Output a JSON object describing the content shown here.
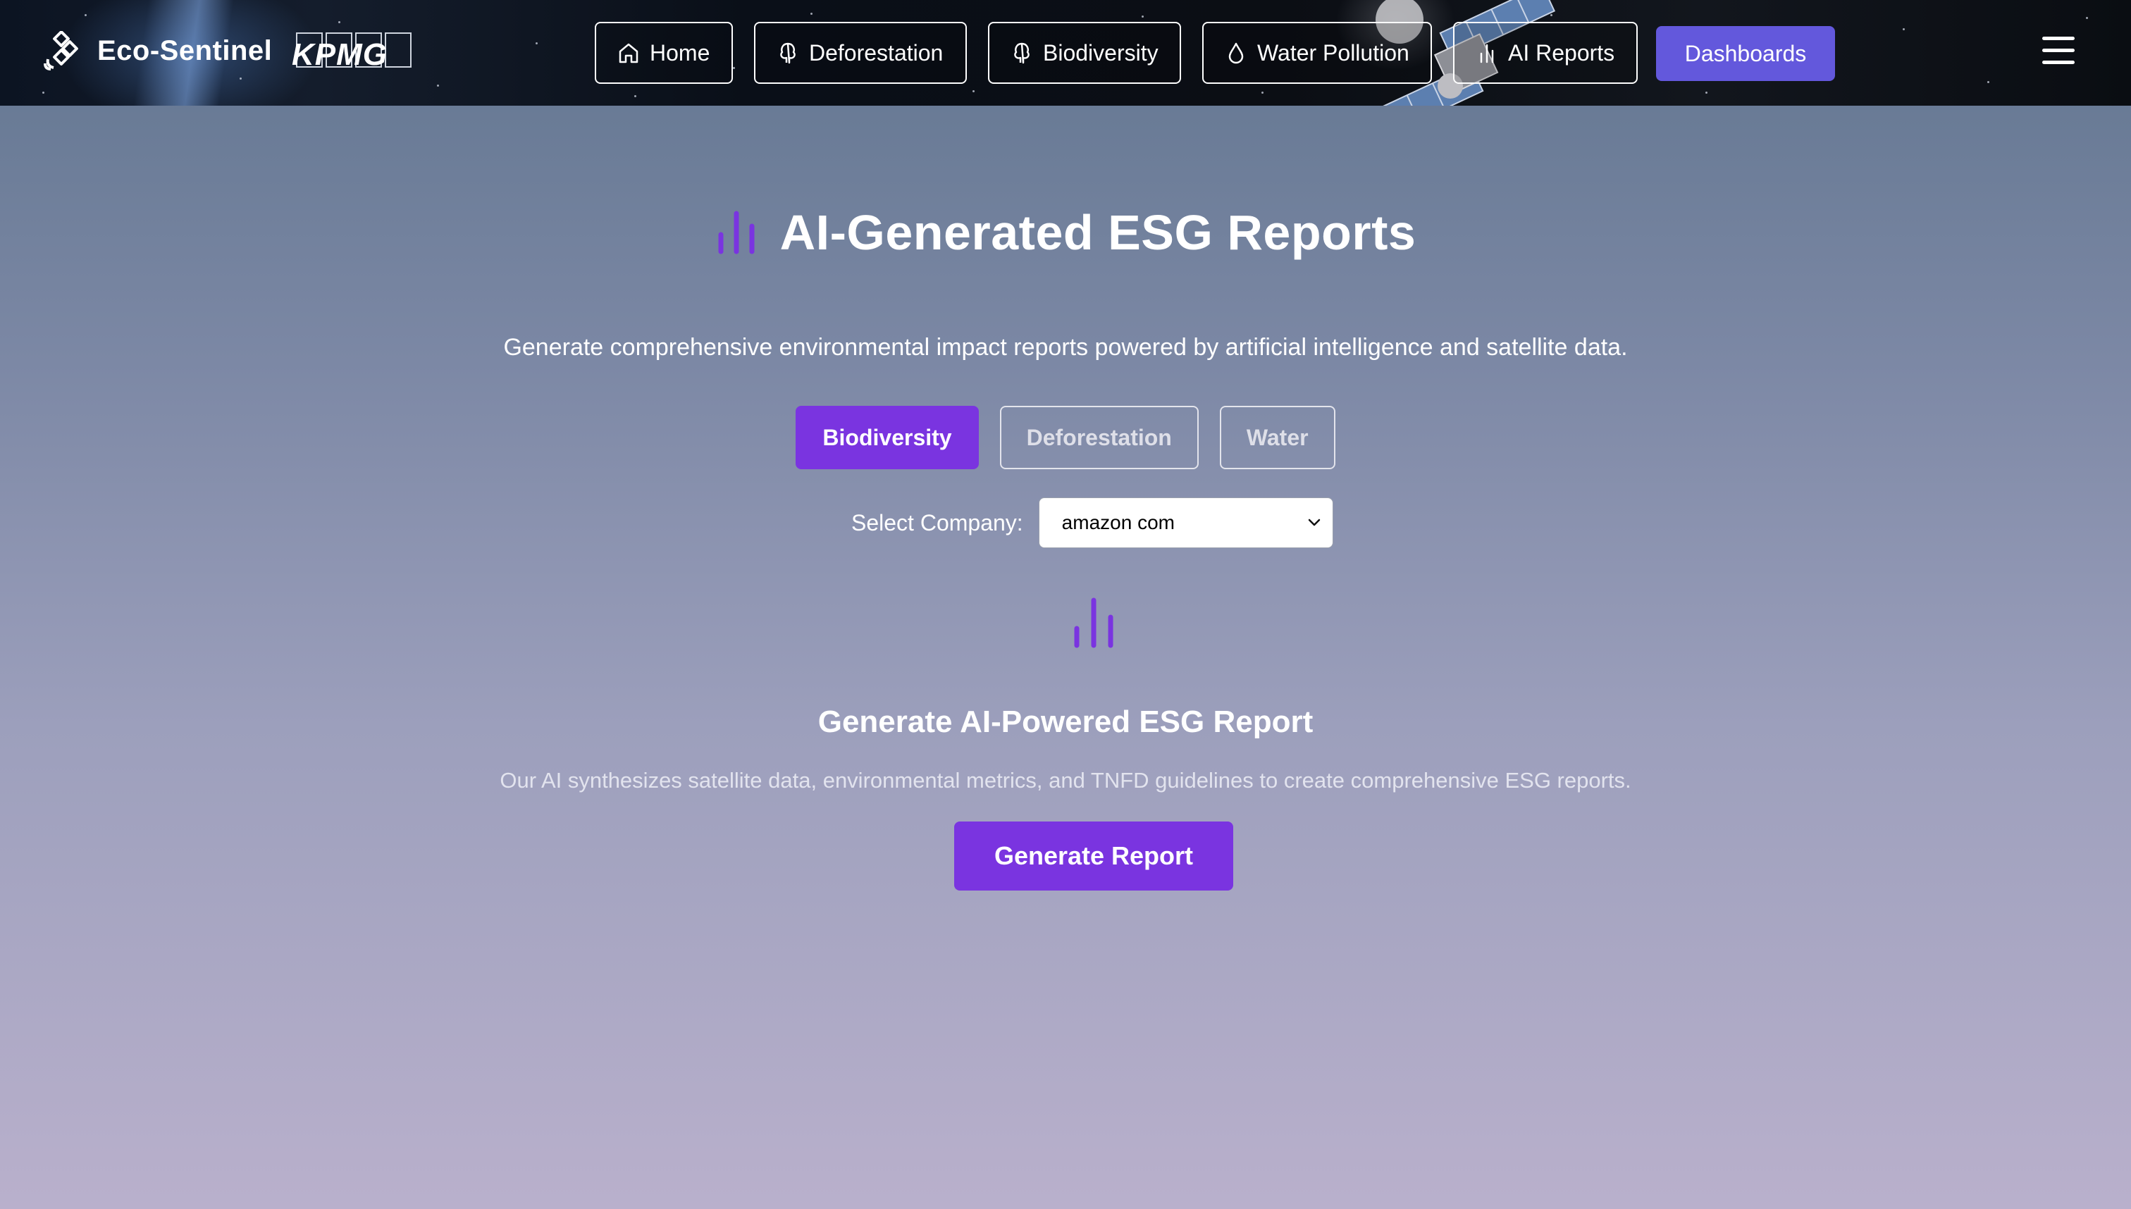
{
  "header": {
    "brand_name": "Eco-Sentinel",
    "partner_logo_text": "KPMG",
    "nav": [
      {
        "label": "Home",
        "icon": "home-icon"
      },
      {
        "label": "Deforestation",
        "icon": "tree-icon"
      },
      {
        "label": "Biodiversity",
        "icon": "tree-icon"
      },
      {
        "label": "Water Pollution",
        "icon": "droplet-icon"
      },
      {
        "label": "AI Reports",
        "icon": "bar-chart-icon"
      }
    ],
    "dashboards_label": "Dashboards",
    "menu_icon": "hamburger-menu-icon"
  },
  "main": {
    "title": "AI-Generated ESG Reports",
    "title_icon": "bar-chart-icon",
    "subtitle": "Generate comprehensive environmental impact reports powered by artificial intelligence and satellite data.",
    "tabs": [
      {
        "label": "Biodiversity",
        "active": true
      },
      {
        "label": "Deforestation",
        "active": false
      },
      {
        "label": "Water",
        "active": false
      }
    ],
    "company_label": "Select Company:",
    "company_selected": "amazon com",
    "section_title": "Generate AI-Powered ESG Report",
    "section_desc": "Our AI synthesizes satellite data, environmental metrics, and TNFD guidelines to create comprehensive ESG reports.",
    "generate_button": "Generate Report"
  },
  "colors": {
    "accent_purple": "#7a34e0",
    "dashboards_button": "#6358dc",
    "header_bg": "#0b0e14"
  }
}
